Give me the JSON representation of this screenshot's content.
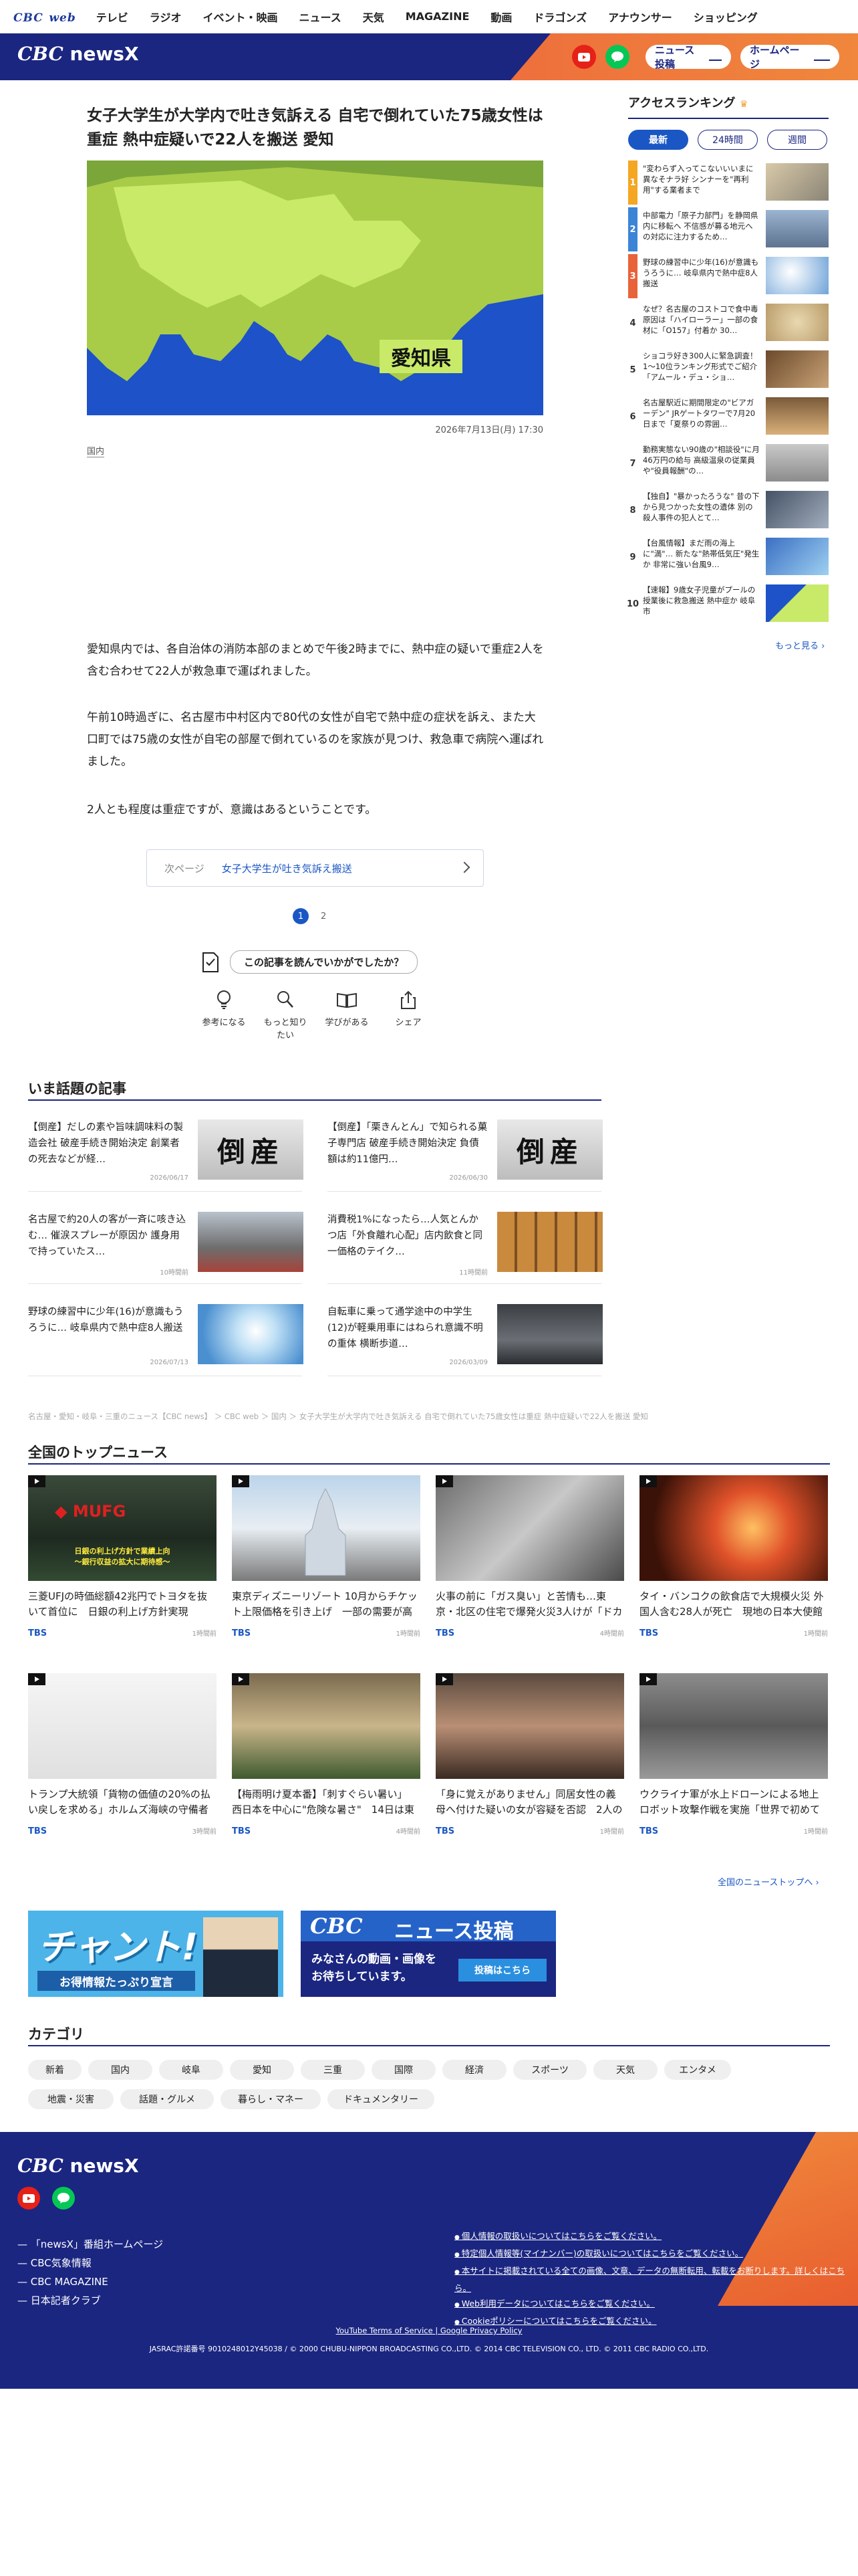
{
  "topnav": {
    "logo_main": "CBC",
    "logo_sub": "web",
    "items": [
      "テレビ",
      "ラジオ",
      "イベント・映画",
      "ニュース",
      "天気",
      "MAGAZINE",
      "動画",
      "ドラゴンズ",
      "アナウンサー",
      "ショッピング"
    ]
  },
  "header": {
    "logo_cbc": "CBC",
    "logo_news": "newsX",
    "post_label": "ニュース投稿",
    "home_label": "ホームページ"
  },
  "article": {
    "title": "女子大学生が大学内で吐き気訴える 自宅で倒れていた75歳女性は重症 熱中症疑いで22人を搬送 愛知",
    "map_label": "愛知県",
    "datetime": "2026年7月13日(月) 17:30",
    "category": "国内",
    "paragraphs": [
      "愛知県内では、各自治体の消防本部のまとめで午後2時までに、熱中症の疑いで重症2人を含む合わせて22人が救急車で運ばれました。",
      "午前10時過ぎに、名古屋市中村区内で80代の女性が自宅で熱中症の症状を訴え、また大口町では75歳の女性が自宅の部屋で倒れているのを家族が見つけ、救急車で病院へ運ばれました。",
      "2人とも程度は重症ですが、意識はあるということです。"
    ],
    "next_label": "次ページ",
    "next_title": "女子大学生が吐き気訴え搬送",
    "pages": [
      "1",
      "2"
    ],
    "feedback_question": "この記事を読んでいかがでしたか？",
    "reactions": [
      "参考になる",
      "もっと知りたい",
      "学びがある",
      "シェア"
    ]
  },
  "sidebar": {
    "title": "アクセスランキング",
    "tabs": [
      "最新",
      "24時間",
      "週間"
    ],
    "ranking": [
      {
        "no": "1",
        "text": "\"変わらず入ってこないいいまに異なそナラ好 シンナーを\"再利用\"する業者まで"
      },
      {
        "no": "2",
        "text": "中部電力「原子力部門」を静岡県内に移転へ 不信感が募る地元への対応に注力するため…"
      },
      {
        "no": "3",
        "text": "野球の練習中に少年(16)が意識もうろうに… 岐阜県内で熱中症8人搬送"
      },
      {
        "no": "4",
        "text": "なぜ？名古屋のコストコで食中毒 原因は「ハイローラー」一部の食材に「O157」付着か 30…"
      },
      {
        "no": "5",
        "text": "ショコラ好き300人に緊急調査！1～10位ランキング形式でご紹介「アムール・デュ・ショ…"
      },
      {
        "no": "6",
        "text": "名古屋駅近に期間限定の\"ビアガーデン\" JRゲートタワーで7月20日まで「夏祭りの雰囲…"
      },
      {
        "no": "7",
        "text": "勤務実態ない90歳の\"相談役\"に月46万円の給与 高級温泉の従業員や\"役員報酬\"の…"
      },
      {
        "no": "8",
        "text": "【独自】\"暴かったろうな\" 昔の下から見つかった女性の遺体 別の殺人事件の犯人とて…"
      },
      {
        "no": "9",
        "text": "【台風情報】まだ雨の海上に\"満\"… 新たな\"熱帯低気圧\"発生か 非常に強い台風9…"
      },
      {
        "no": "10",
        "text": "【速報】9歳女子児童がプールの授業後に救急搬送 熱中症か 岐阜市"
      }
    ],
    "more_label": "もっと見る"
  },
  "popular": {
    "title": "いま話題の記事",
    "items": [
      {
        "title": "【倒産】だしの素や旨味調味料の製造会社 破産手続き開始決定 創業者の死去などが経…",
        "date": "2026/06/17"
      },
      {
        "title": "【倒産】「栗きんとん」で知られる菓子専門店 破産手続き開始決定 負債額は約11億円…",
        "date": "2026/06/30"
      },
      {
        "title": "名古屋で約20人の客が一斉に咳き込む… 催涙スプレーが原因か 護身用で持っていたス…",
        "date": "10時間前"
      },
      {
        "title": "消費税1%になったら…人気とんかつ店「外食離れ心配」店内飲食と同一価格のテイク…",
        "date": "11時間前"
      },
      {
        "title": "野球の練習中に少年(16)が意識もうろうに… 岐阜県内で熱中症8人搬送",
        "date": "2026/07/13"
      },
      {
        "title": "自転車に乗って通学途中の中学生(12)が軽乗用車にはねられ意識不明の重体 横断歩道…",
        "date": "2026/03/09"
      }
    ],
    "tosan_label": "倒産"
  },
  "breadcrumb": "名古屋・愛知・岐阜・三重のニュース【CBC news】 ＞ CBC web ＞ 国内 ＞ 女子大学生が大学内で吐き気訴える 自宅で倒れていた75歳女性は重症 熱中症疑いで22人を搬送 愛知",
  "topnews": {
    "title": "全国のトップニュース",
    "items": [
      {
        "title": "三菱UFJの時価総額42兆円でトヨタを抜いて首位に　日銀の利上げ方針実現",
        "source": "TBS",
        "time": "1時間前",
        "overlay": "日銀の利上げ方針で業績上向\n～銀行収益の拡大に期待感～"
      },
      {
        "title": "東京ディズニーリゾート 10月からチケット上限価格を引き上げ　一部の需要が高い日のみ対象に「1デーパスポ…",
        "source": "TBS",
        "time": "1時間前"
      },
      {
        "title": "火事の前に「ガス臭い」と苦情も…東京・北区の住宅で爆発火災3人けが「ドカーンと突き上げるような音…",
        "source": "TBS",
        "time": "4時間前"
      },
      {
        "title": "タイ・バンコクの飲食店で大規模火災 外国人含む28人が死亡　現地の日本大使館「日本人の被害情報なし」",
        "source": "TBS",
        "time": "1時間前"
      },
      {
        "title": "トランプ大統領「貨物の価値の20%の払い戻しを求める」ホルムズ海峡の守備者として通航する船舶の安全を確保…",
        "source": "TBS",
        "time": "3時間前"
      },
      {
        "title": "【梅雨明け夏本番】「刺すぐらい暑い」 西日本を中心に\"危険な暑さ\"　14日は東日本でも「猛暑日」続出か…熱中…",
        "source": "TBS",
        "time": "4時間前"
      },
      {
        "title": "「身に覚えがありません」同居女性の義母へ付けた疑いの女が容疑を否認　2人の関係性について捜査進める",
        "source": "TBS",
        "time": "1時間前"
      },
      {
        "title": "ウクライナ軍が水上ドローンによる地上ロボット攻撃作戦を実施「世界で初めて確認された戦闘任務」",
        "source": "TBS",
        "time": "1時間前"
      }
    ],
    "all_label": "全国のニューストップへ"
  },
  "banners": {
    "chant_title": "チャント!",
    "chant_sub": "お得情報たっぷり宣言",
    "post_logo": "CBC",
    "post_title": "ニュース投稿",
    "post_sub": "みなさんの動画・画像を\nお待ちしています。",
    "post_button": "投稿はこちら"
  },
  "categories": {
    "title": "カテゴリ",
    "row1": [
      "新着",
      "国内",
      "岐阜",
      "愛知",
      "三重",
      "国際",
      "経済",
      "スポーツ",
      "天気",
      "エンタメ"
    ],
    "row2": [
      "地震・災害",
      "話題・グルメ",
      "暮らし・マネー",
      "ドキュメンタリー"
    ]
  },
  "footer": {
    "logo_cbc": "CBC",
    "logo_news": "newsX",
    "links_left": [
      "「newsX」番組ホームページ",
      "CBC気象情報",
      "CBC MAGAZINE",
      "日本記者クラブ"
    ],
    "links_right": [
      "個人情報の取扱いについてはこちらをご覧ください。",
      "特定個人情報等(マイナンバー)の取扱いについてはこちらをご覧ください。",
      "本サイトに掲載されている全ての画像、文章、データの無断転用、転載をお断りします。詳しくはこちら。",
      "Web利用データについてはこちらをご覧ください。",
      "Cookieポリシーについてはこちらをご覧ください。"
    ],
    "yt_terms": "YouTube Terms of Service",
    "google_privacy": "Google Privacy Policy",
    "copyright": "JASRAC許諾番号 9010248012Y45038 / © 2000 CHUBU-NIPPON BROADCASTING CO.,LTD. © 2014 CBC TELEVISION CO., LTD. © 2011 CBC RADIO CO.,LTD."
  },
  "colors": {
    "brand_navy": "#1b2681",
    "accent_blue": "#1b57c4",
    "accent_orange": "#f0873c",
    "rank1": "#f5a623",
    "rank2": "#3c84d6",
    "rank3": "#e8623a"
  }
}
